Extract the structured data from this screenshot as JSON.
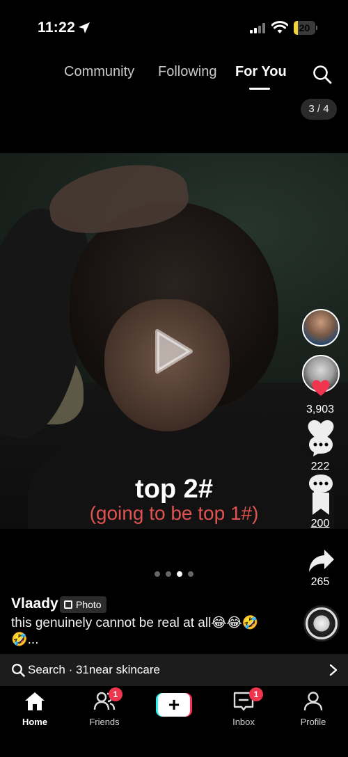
{
  "status": {
    "time": "11:22",
    "battery": "20",
    "battery_level": 0.2
  },
  "top_tabs": [
    {
      "label": "Community"
    },
    {
      "label": "Following"
    },
    {
      "label": "For You"
    }
  ],
  "page_indicator": "3 / 4",
  "video": {
    "caption_line1": "top 2#",
    "caption_line2": "(going to be top 1#)"
  },
  "actions": {
    "likes": "3,903",
    "comments": "222",
    "bookmarks": "200",
    "shares": "265"
  },
  "post": {
    "username": "Vlaady",
    "badge": "Photo",
    "description": "this genuinely cannot be real at all😂😂🤣🤣..."
  },
  "search_bar": {
    "text": "Search · 31near skincare"
  },
  "bottom_nav": {
    "home": "Home",
    "friends": "Friends",
    "friends_badge": "1",
    "inbox": "Inbox",
    "inbox_badge": "1",
    "profile": "Profile",
    "create": "+"
  },
  "colors": {
    "accent": "#fe2c55",
    "cyan": "#25f4ee",
    "caption_red": "#e0524f"
  }
}
